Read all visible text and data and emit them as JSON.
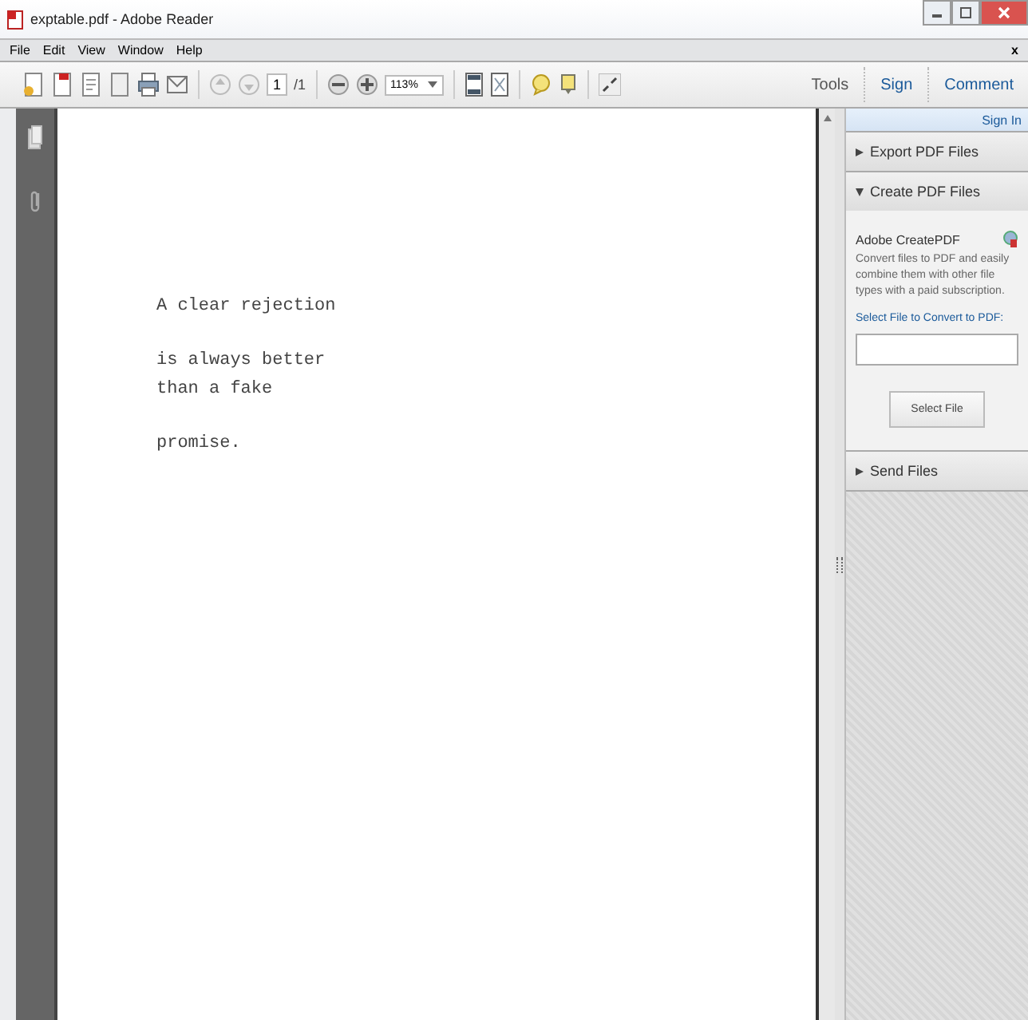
{
  "window": {
    "title": "exptable.pdf - Adobe Reader"
  },
  "menu": [
    "File",
    "Edit",
    "View",
    "Window",
    "Help"
  ],
  "menu_close": "x",
  "toolbar": {
    "page": "1",
    "page_total": "/1",
    "zoom": "113%"
  },
  "tool_tabs": [
    "Tools",
    "Sign",
    "Comment"
  ],
  "document": {
    "paragraphs": [
      [
        "A clear rejection"
      ],
      [
        "is always better",
        "than a fake"
      ],
      [
        "promise."
      ]
    ]
  },
  "panel": {
    "sign_in": "Sign In",
    "sections": [
      {
        "title": "Export PDF Files",
        "expanded": false
      },
      {
        "title": "Create PDF Files",
        "expanded": true,
        "heading": "Adobe CreatePDF",
        "description": "Convert files to PDF and easily combine them with other file types with a paid subscription.",
        "link": "Select File to Convert to PDF:",
        "button": "Select File"
      },
      {
        "title": "Send Files",
        "expanded": false
      }
    ]
  }
}
